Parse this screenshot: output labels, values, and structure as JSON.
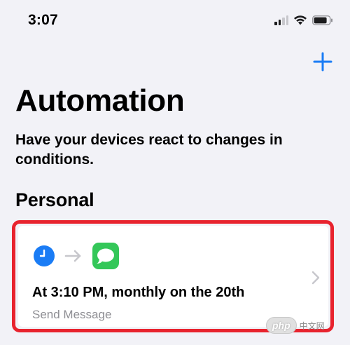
{
  "status_bar": {
    "time": "3:07",
    "icons": [
      "cellular-signal-icon",
      "wifi-icon",
      "battery-icon"
    ]
  },
  "header": {
    "add_icon": "plus-icon"
  },
  "page": {
    "title": "Automation",
    "subtitle": "Have your devices react to changes in conditions."
  },
  "section": {
    "title": "Personal"
  },
  "automations": [
    {
      "trigger_icon": "clock-icon",
      "arrow_icon": "arrow-right-icon",
      "action_icon": "messages-icon",
      "title": "At 3:10 PM, monthly on the 20th",
      "subtitle": "Send Message",
      "chevron_icon": "chevron-right-icon"
    }
  ],
  "watermark": {
    "logo": "php",
    "text": "中文网"
  },
  "colors": {
    "background": "#f2f2f7",
    "accent": "#1a7cf5",
    "highlight": "#e8232e",
    "messages_green": "#34c759",
    "secondary_text": "#8e8e93"
  }
}
